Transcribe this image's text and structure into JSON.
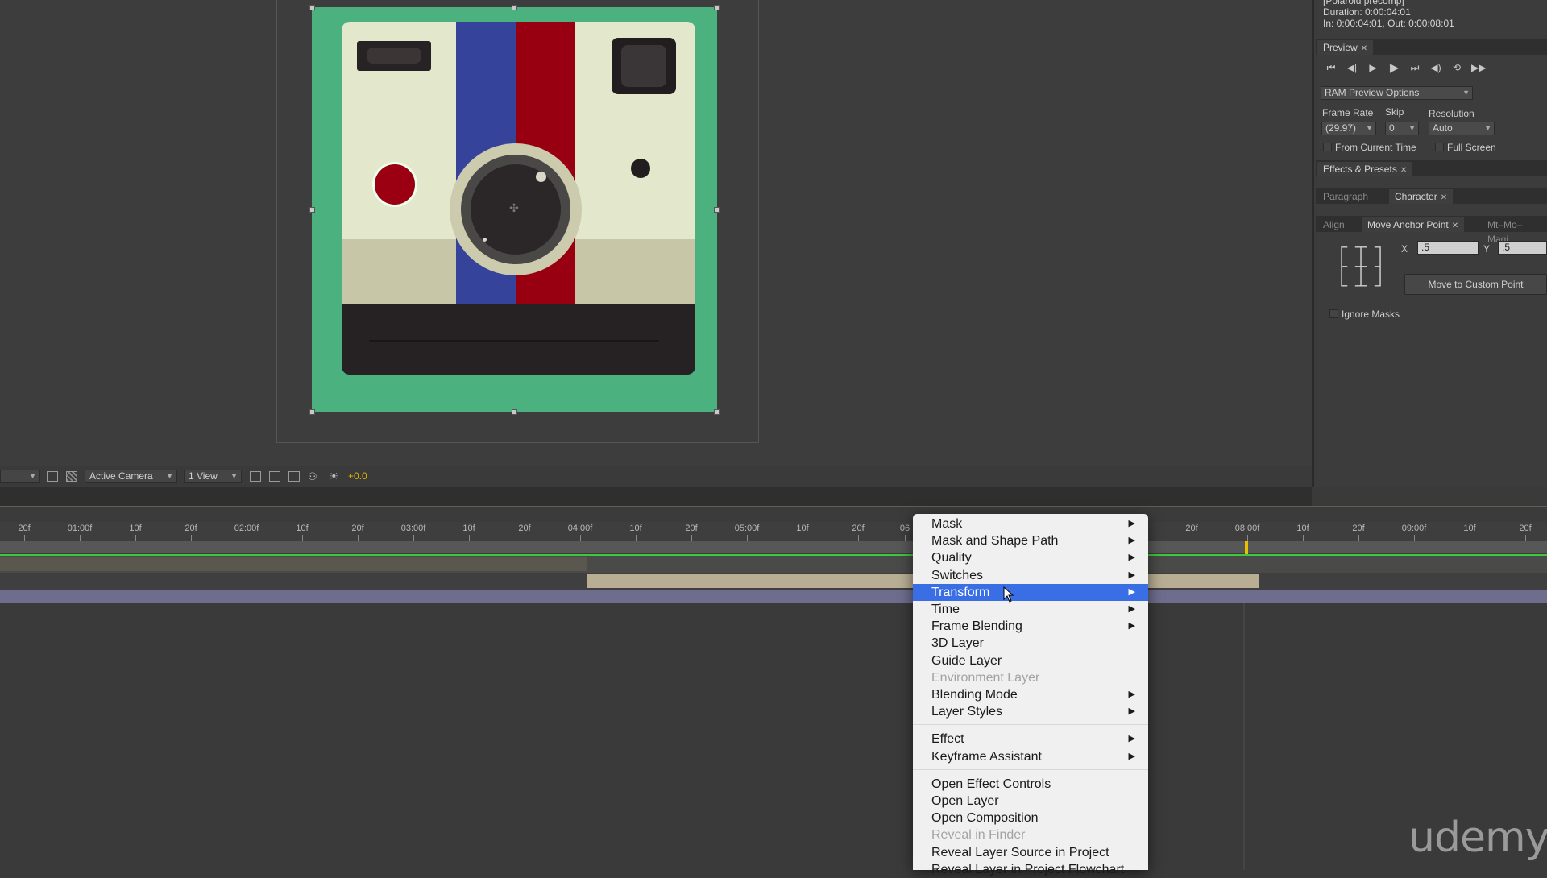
{
  "info": {
    "comp_name": "[Polaroid precomp]",
    "duration": "Duration: 0:00:04:01",
    "in_out": "In: 0:00:04:01, Out: 0:00:08:01"
  },
  "preview": {
    "tab_label": "Preview",
    "ram_options": "RAM Preview Options",
    "frame_rate_label": "Frame Rate",
    "frame_rate_value": "(29.97)",
    "skip_label": "Skip",
    "skip_value": "0",
    "resolution_label": "Resolution",
    "resolution_value": "Auto",
    "from_current_time": "From Current Time",
    "full_screen": "Full Screen"
  },
  "panels": {
    "effects_presets": "Effects & Presets",
    "paragraph": "Paragraph",
    "character": "Character",
    "align": "Align",
    "move_anchor_point": "Move Anchor Point",
    "mt_mo": "Mt–Mo–Magi"
  },
  "anchor": {
    "x_label": "X",
    "x_value": ".5",
    "y_label": "Y",
    "y_value": ".5",
    "move_button": "Move to Custom Point",
    "ignore_masks": "Ignore Masks"
  },
  "viewer_toolbar": {
    "camera": "Active Camera",
    "view": "1 View",
    "exposure": "+0.0"
  },
  "ruler": {
    "labels": [
      "20f",
      "01:00f",
      "10f",
      "20f",
      "02:00f",
      "10f",
      "20f",
      "03:00f",
      "10f",
      "20f",
      "04:00f",
      "10f",
      "20f",
      "05:00f",
      "10f",
      "20f",
      "06",
      "20f",
      "08:00f",
      "10f",
      "20f",
      "09:00f",
      "10f",
      "20f"
    ]
  },
  "menu": {
    "items": [
      {
        "label": "Mask",
        "submenu": true
      },
      {
        "label": "Mask and Shape Path",
        "submenu": true
      },
      {
        "label": "Quality",
        "submenu": true
      },
      {
        "label": "Switches",
        "submenu": true
      },
      {
        "label": "Transform",
        "submenu": true,
        "selected": true
      },
      {
        "label": "Time",
        "submenu": true
      },
      {
        "label": "Frame Blending",
        "submenu": true
      },
      {
        "label": "3D Layer",
        "submenu": false
      },
      {
        "label": "Guide Layer",
        "submenu": false
      },
      {
        "label": "Environment Layer",
        "submenu": false,
        "disabled": true
      },
      {
        "label": "Blending Mode",
        "submenu": true
      },
      {
        "label": "Layer Styles",
        "submenu": true
      },
      {
        "label": "Effect",
        "submenu": true
      },
      {
        "label": "Keyframe Assistant",
        "submenu": true
      },
      {
        "label": "Open Effect Controls",
        "submenu": false
      },
      {
        "label": "Open Layer",
        "submenu": false
      },
      {
        "label": "Open Composition",
        "submenu": false
      },
      {
        "label": "Reveal in Finder",
        "submenu": false,
        "disabled": true
      },
      {
        "label": "Reveal Layer Source in Project",
        "submenu": false
      },
      {
        "label": "Reveal Layer in Project Flowchart",
        "submenu": false
      }
    ]
  },
  "watermark": "udemy",
  "colors": {
    "accent_selected": "#3a6ee5",
    "timeline_green": "#3ec83e",
    "cti_yellow": "#e8c000",
    "art_background": "#4bb17f",
    "stripe_blue": "#36439a",
    "stripe_red": "#980012"
  }
}
